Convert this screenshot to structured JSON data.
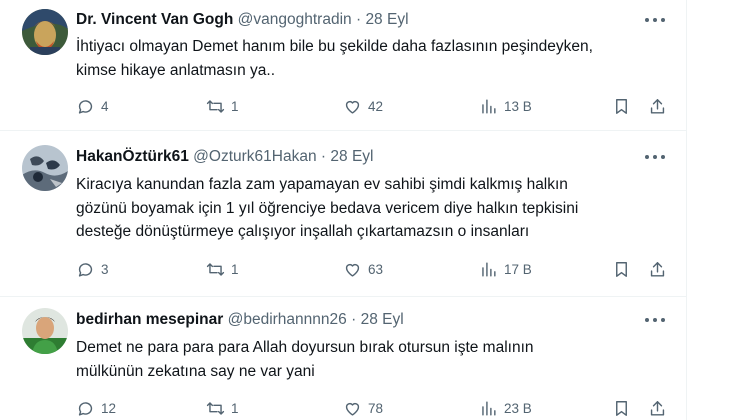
{
  "tweets": [
    {
      "name": "Dr. Vincent Van Gogh",
      "handle": "@vangoghtradin",
      "separator": "·",
      "date": "28 Eyl",
      "lines": [
        "İhtiyacı olmayan Demet hanım bile bu şekilde daha fazlasının peşindeyken,",
        "kimse hikaye anlatmasın ya.."
      ],
      "replies": "4",
      "retweets": "1",
      "likes": "42",
      "views": "13 B"
    },
    {
      "name": "HakanÖztürk61",
      "handle": "@Ozturk61Hakan",
      "separator": "·",
      "date": "28 Eyl",
      "lines": [
        "Kiracıya kanundan fazla zam yapamayan ev sahibi şimdi kalkmış halkın",
        "gözünü boyamak için  1 yıl öğrenciye bedava vericem diye halkın tepkisini",
        "desteğe dönüştürmeye çalışıyor inşallah çıkartamazsın o insanları"
      ],
      "replies": "3",
      "retweets": "1",
      "likes": "63",
      "views": "17 B"
    },
    {
      "name": "bedirhan mesepinar",
      "handle": "@bedirhannnn26",
      "separator": "·",
      "date": "28 Eyl",
      "lines": [
        "Demet ne para para para Allah doyursun bırak otursun işte malının",
        "mülkünün zekatına say ne var yani"
      ],
      "replies": "12",
      "retweets": "1",
      "likes": "78",
      "views": "23 B"
    }
  ],
  "icons": {
    "reply": "reply-icon",
    "retweet": "retweet-icon",
    "like": "heart-icon",
    "views": "views-icon",
    "bookmark": "bookmark-icon",
    "share": "share-icon",
    "more": "more-icon"
  },
  "colors": {
    "text": "#0f1419",
    "secondary": "#536471",
    "divider": "#eff3f4"
  }
}
